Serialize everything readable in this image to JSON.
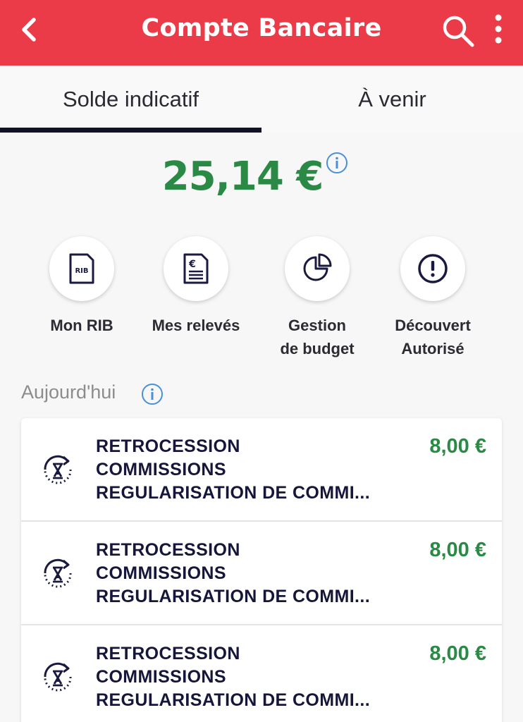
{
  "header": {
    "title": "Compte Bancaire",
    "back_icon": "chevron-left-icon",
    "search_icon": "search-icon",
    "menu_icon": "more-vertical-icon",
    "color": "#ec3b48"
  },
  "tabs": [
    {
      "label": "Solde indicatif",
      "active": true
    },
    {
      "label": "À venir",
      "active": false
    }
  ],
  "balance": {
    "amount": "25,14 €",
    "color": "#2a8a45",
    "info_icon": "info-icon"
  },
  "actions": [
    {
      "label_line1": "Mon RIB",
      "label_line2": "",
      "icon": "rib-card-icon"
    },
    {
      "label_line1": "Mes relevés",
      "label_line2": "",
      "icon": "euro-document-icon"
    },
    {
      "label_line1": "Gestion",
      "label_line2": "de budget",
      "icon": "pie-chart-icon"
    },
    {
      "label_line1": "Découvert",
      "label_line2": "Autorisé",
      "icon": "exclamation-circle-icon"
    }
  ],
  "section": {
    "label": "Aujourd'hui",
    "info_icon": "info-icon"
  },
  "transactions": [
    {
      "line1": "RETROCESSION",
      "line2": "COMMISSIONS",
      "line3": "REGULARISATION DE COMMI...",
      "amount": "8,00 €",
      "icon": "pending-hourglass-icon"
    },
    {
      "line1": "RETROCESSION",
      "line2": "COMMISSIONS",
      "line3": "REGULARISATION DE COMMI...",
      "amount": "8,00 €",
      "icon": "pending-hourglass-icon"
    },
    {
      "line1": "RETROCESSION",
      "line2": "COMMISSIONS",
      "line3": "REGULARISATION DE COMMI...",
      "amount": "8,00 €",
      "icon": "pending-hourglass-icon"
    }
  ]
}
